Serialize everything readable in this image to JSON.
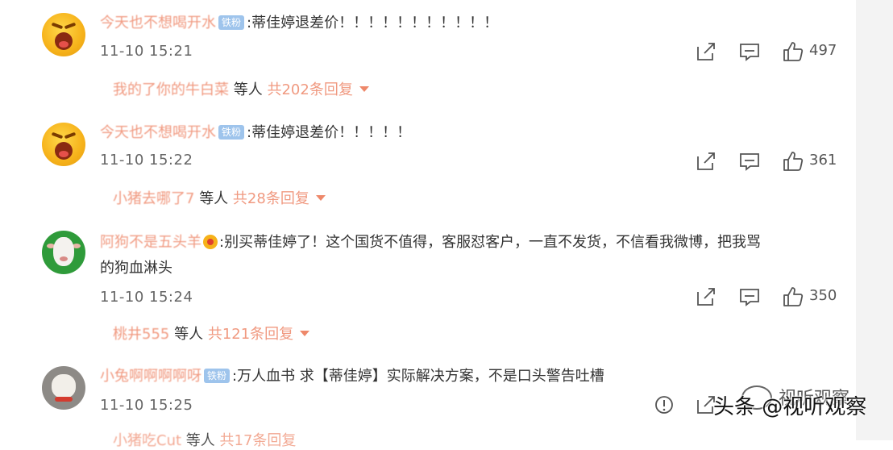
{
  "comments": [
    {
      "username": "今天也不想喝开水",
      "badge": "铁粉",
      "text": ":蒂佳婷退差价！！！！！！！！！！！",
      "text2": "",
      "time": "11-10 15:21",
      "likes": "497",
      "reply_user": "我的了你的牛白菜",
      "reply_deng": "等人",
      "reply_count": "共202条回复"
    },
    {
      "username": "今天也不想喝开水",
      "badge": "铁粉",
      "text": ":蒂佳婷退差价！！！！！",
      "text2": "",
      "time": "11-10 15:22",
      "likes": "361",
      "reply_user": "小猪去哪了7",
      "reply_deng": "等人",
      "reply_count": "共28条回复"
    },
    {
      "username": "阿狗不是五头羊",
      "badge": "",
      "text": ":别买蒂佳婷了！这个国货不值得，客服怼客户，一直不发货，不信看我微博，把我骂",
      "text2": "的狗血淋头",
      "time": "11-10 15:24",
      "likes": "350",
      "reply_user": "桃井555",
      "reply_deng": "等人",
      "reply_count": "共121条回复"
    },
    {
      "username": "小兔啊啊啊啊呀",
      "badge": "铁粉",
      "text": ":万人血书 求【蒂佳婷】实际解决方案，不是口头警告吐槽",
      "text2": "",
      "time": "11-10 15:25",
      "likes": "",
      "reply_user": "小猪吃Cut",
      "reply_deng": "等人",
      "reply_count": "共17条回复"
    }
  ],
  "watermark": {
    "main": "头条 @视听观察",
    "top": "视听观察"
  }
}
